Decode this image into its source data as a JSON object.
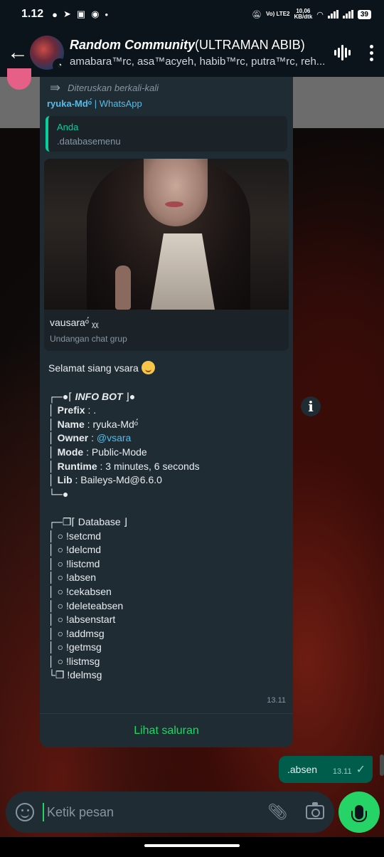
{
  "status_bar": {
    "time": "1.12",
    "network": "Vo) LTE2",
    "speed_value": "10,06",
    "speed_unit": "KB/dtk",
    "battery": "39"
  },
  "header": {
    "title_main": "Random Community",
    "title_sub": "(ULTRAMAN ABIB)",
    "members": "amabara™rc, asa™acyeh, habib™rc, putra™rc, reh..."
  },
  "forwarded_message": {
    "forward_label": "Diteruskan berkali-kali",
    "sender": "ryuka-Mdᵒ́",
    "sender_suffix": "| WhatsApp",
    "quote": {
      "author": "Anda",
      "text": ".databasemenu"
    },
    "invite": {
      "group_name": "vausaraᵒ́ ᵪᵪ",
      "subtitle": "Undangan chat grup"
    },
    "greeting": "Selamat siang vsara",
    "info_header": "INFO BOT",
    "info_rows": [
      {
        "key": "Prefix",
        "value": " : ."
      },
      {
        "key": "Name",
        "value": " : ryuka-Mdᵒ́"
      },
      {
        "key": "Owner",
        "value": " : ",
        "mention": "@vsara"
      },
      {
        "key": "Mode",
        "value": " : Public-Mode"
      },
      {
        "key": "Runtime",
        "value": " : 3 minutes, 6 seconds"
      },
      {
        "key": "Lib",
        "value": " : Baileys-Md@6.6.0"
      }
    ],
    "database_header": "Database",
    "database_items": [
      "!setcmd",
      "!delcmd",
      "!listcmd",
      "!absen",
      "!cekabsen",
      "!deleteabsen",
      "!absenstart",
      "!addmsg",
      "!getmsg",
      "!listmsg"
    ],
    "database_last": "!delmsg",
    "time": "13.11",
    "action": "Lihat saluran"
  },
  "outgoing_message": {
    "text": ".absen",
    "time": "13.11"
  },
  "composer": {
    "placeholder": "Ketik pesan"
  }
}
